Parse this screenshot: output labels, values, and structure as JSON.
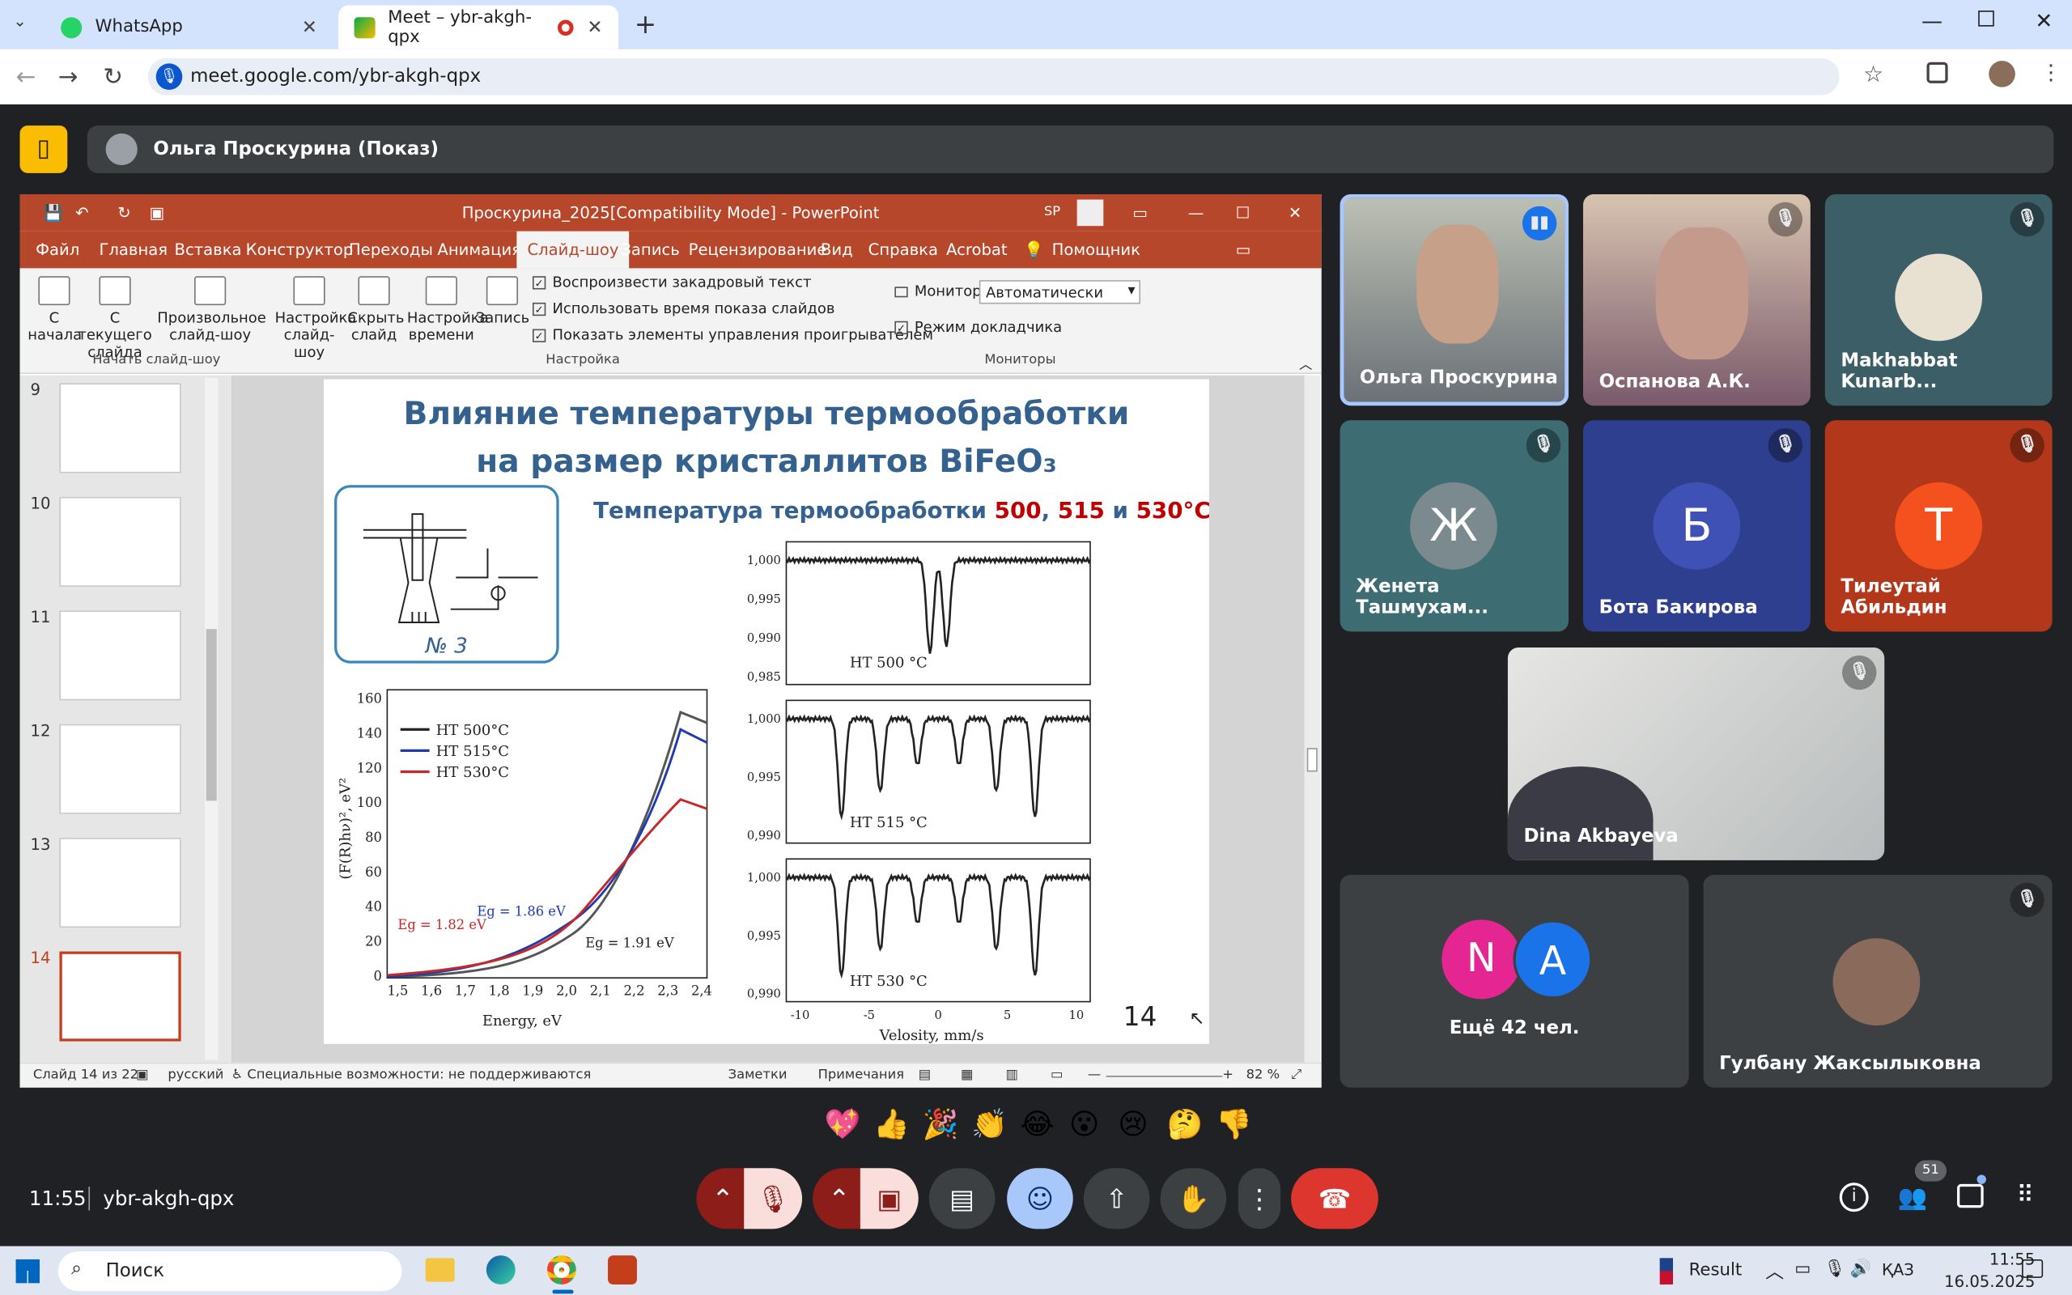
{
  "browser": {
    "tabs": [
      {
        "title": "WhatsApp"
      },
      {
        "title": "Meet – ybr-akgh-qpx"
      }
    ],
    "url": "meet.google.com/ybr-akgh-qpx"
  },
  "meet": {
    "presenter_label": "Ольга Проскурина (Показ)",
    "time": "11:55",
    "meeting_code": "ybr-akgh-qpx",
    "participants_badge": "51",
    "more_people": "Ещё 42 чел.",
    "reactions": [
      "💖",
      "👍",
      "🎉",
      "👏",
      "😂",
      "😮",
      "😢",
      "🤔",
      "👎"
    ],
    "tiles": [
      {
        "name": "Ольга Проскурина"
      },
      {
        "name": "Оспанова А.К."
      },
      {
        "name": "Makhabbat Kunarb..."
      },
      {
        "name": "Женета Ташмухам...",
        "initial": "Ж",
        "color": "#7a8a8f"
      },
      {
        "name": "Бота Бакирова",
        "initial": "Б",
        "color": "#3f51b5"
      },
      {
        "name": "Тилеутай Абильдин",
        "initial": "T",
        "color": "#f4511e"
      },
      {
        "name": "Dina Akbayeva"
      },
      {
        "name": "Гулбану Жаксылыковна"
      }
    ],
    "more_initials": [
      {
        "letter": "N",
        "color": "#e52592"
      },
      {
        "letter": "A",
        "color": "#1a73e8"
      }
    ]
  },
  "ppt": {
    "title": "Проскурина_2025[Compatibility Mode] - PowerPoint",
    "user_initials": "SP",
    "menu": [
      "Файл",
      "Главная",
      "Вставка",
      "Конструктор",
      "Переходы",
      "Анимация",
      "Слайд-шоу",
      "Запись",
      "Рецензирование",
      "Вид",
      "Справка",
      "Acrobat",
      "Помощник"
    ],
    "ribbon": {
      "buttons": [
        "С начала",
        "С текущего слайда",
        "Произвольное слайд-шоу",
        "Настройка слайд-шоу",
        "Скрыть слайд",
        "Настройка времени",
        "Запись"
      ],
      "group1": "Начать слайд-шоу",
      "group2": "Настройка",
      "group3": "Мониторы",
      "checks": [
        "Воспроизвести закадровый текст",
        "Использовать время показа слайдов",
        "Показать элементы управления проигрывателем"
      ],
      "monitor_label": "Монитор:",
      "monitor_value": "Автоматически",
      "presenter_mode": "Режим докладчика"
    },
    "thumb_numbers": [
      "9",
      "10",
      "11",
      "12",
      "13",
      "14"
    ],
    "status": {
      "slide": "Слайд 14 из 22",
      "lang": "русский",
      "access": "Специальные возможности: не поддерживаются",
      "notes": "Заметки",
      "comments": "Примечания",
      "zoom": "82 %"
    }
  },
  "slide": {
    "title_line1": "Влияние температуры термообработки",
    "title_line2": "на размер кристаллитов BiFeO₃",
    "subtitle_pre": "Температура термообработки ",
    "t1": "500",
    "sep1": ", ",
    "t2": "515",
    "sep2": " и ",
    "t3": "530°C",
    "device_label": "№ 3",
    "page_number": "14",
    "tauc": {
      "legend": [
        "HT 500°C",
        "HT 515°C",
        "HT 530°C"
      ],
      "xlabel": "Energy, eV",
      "ylabel": "(F(R)hν)², eV²",
      "yticks": [
        "0",
        "20",
        "40",
        "60",
        "80",
        "100",
        "120",
        "140",
        "160"
      ],
      "xticks": [
        "1,5",
        "1,6",
        "1,7",
        "1,8",
        "1,9",
        "2,0",
        "2,1",
        "2,2",
        "2,3",
        "2,4"
      ],
      "eg1": "Eg = 1.82 eV",
      "eg2": "Eg = 1.86 eV",
      "eg3": "Eg = 1.91 eV"
    },
    "mossbauer": {
      "panels": [
        {
          "label": "HT 500 °C",
          "yticks": [
            "1,000",
            "0,995",
            "0,990",
            "0,985"
          ]
        },
        {
          "label": "HT 515 °C",
          "yticks": [
            "1,000",
            "0,995",
            "0,990"
          ]
        },
        {
          "label": "HT 530 °C",
          "yticks": [
            "1,000",
            "0,995",
            "0,990"
          ]
        }
      ],
      "xticks": [
        "-10",
        "-5",
        "0",
        "5",
        "10"
      ],
      "xlabel": "Velosity, mm/s"
    }
  },
  "taskbar": {
    "search": "Поиск",
    "result": "Result",
    "lang": "ҚАЗ",
    "clock_time": "11:55",
    "clock_date": "16.05.2025"
  }
}
